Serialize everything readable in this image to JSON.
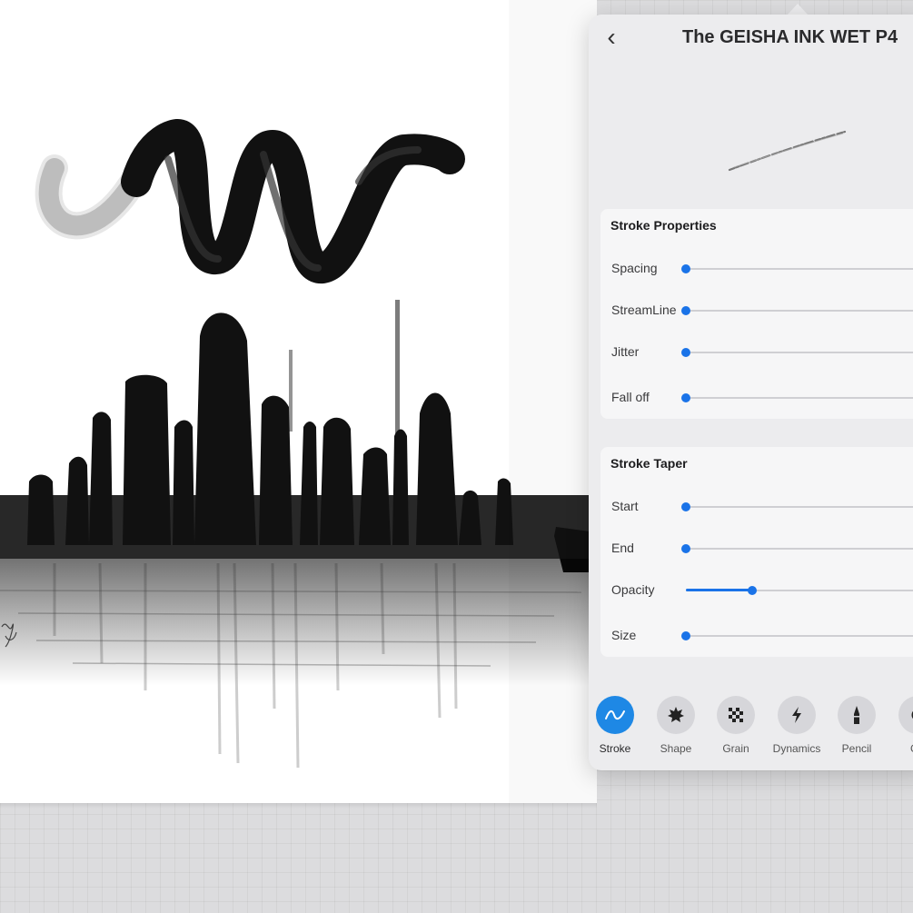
{
  "brush_panel": {
    "title": "The GEISHA INK WET P4",
    "back_glyph": "‹"
  },
  "stroke_properties": {
    "title": "Stroke Properties",
    "rows": [
      {
        "label": "Spacing",
        "value": 0.0
      },
      {
        "label": "StreamLine",
        "value": 0.0
      },
      {
        "label": "Jitter",
        "value": 0.0
      },
      {
        "label": "Fall off",
        "value": 0.0
      }
    ]
  },
  "stroke_taper": {
    "title": "Stroke Taper",
    "rows": [
      {
        "label": "Start",
        "value": 0.0
      },
      {
        "label": "End",
        "value": 0.0
      },
      {
        "label": "Opacity",
        "value": 0.28
      },
      {
        "label": "Size",
        "value": 0.0
      }
    ]
  },
  "tabs": [
    {
      "label": "Stroke",
      "icon": "stroke-path-icon",
      "active": true
    },
    {
      "label": "Shape",
      "icon": "shape-icon",
      "active": false
    },
    {
      "label": "Grain",
      "icon": "grain-icon",
      "active": false
    },
    {
      "label": "Dynamics",
      "icon": "lightning-icon",
      "active": false
    },
    {
      "label": "Pencil",
      "icon": "pencil-icon",
      "active": false
    },
    {
      "label": "Ge",
      "icon": "gear-icon",
      "active": false
    }
  ],
  "colors": {
    "accent": "#1a73e8",
    "active_tab": "#1e88e5",
    "panel": "#ececee",
    "card": "#f6f6f7",
    "canvas": "#ffffff",
    "background": "#dcdcde"
  }
}
